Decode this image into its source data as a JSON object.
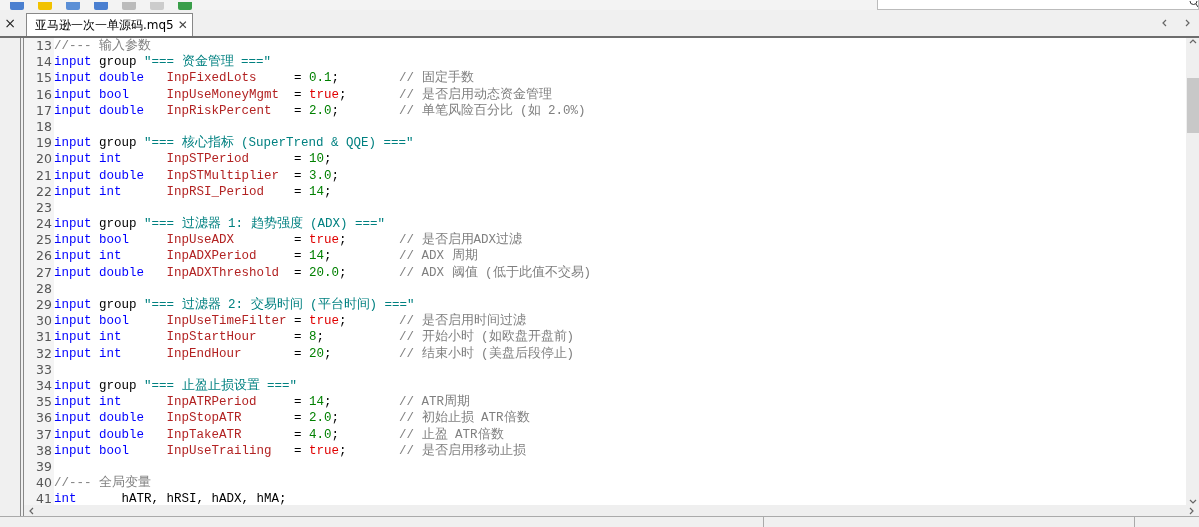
{
  "panel_close": "×",
  "tabs": [
    {
      "label": "亚马逊一次一单源码.mq5",
      "selected": true,
      "close": "✕"
    }
  ],
  "editor": {
    "lines": [
      {
        "number": "13",
        "tokens": [
          {
            "kind": "comment",
            "text": "//--- 输入参数"
          }
        ]
      },
      {
        "number": "14",
        "tokens": [
          {
            "kind": "keyword",
            "text": "input"
          },
          {
            "kind": "word",
            "text": "group"
          },
          {
            "kind": "string",
            "text": "\"=== 资金管理 ===\""
          }
        ]
      },
      {
        "number": "15",
        "tokens": [
          {
            "kind": "keyword",
            "text": "input"
          },
          {
            "kind": "type",
            "text": "double"
          },
          {
            "kind": "name",
            "text": "InpFixedLots"
          },
          {
            "kind": "op",
            "text": "="
          },
          {
            "kind": "number",
            "text": "0.1"
          },
          {
            "kind": "punct",
            "text": ";"
          },
          {
            "kind": "comment",
            "text": "// 固定手数"
          }
        ]
      },
      {
        "number": "16",
        "tokens": [
          {
            "kind": "keyword",
            "text": "input"
          },
          {
            "kind": "type",
            "text": "bool"
          },
          {
            "kind": "name",
            "text": "InpUseMoneyMgmt"
          },
          {
            "kind": "op",
            "text": "="
          },
          {
            "kind": "bool",
            "text": "true"
          },
          {
            "kind": "punct",
            "text": ";"
          },
          {
            "kind": "comment",
            "text": "// 是否启用动态资金管理"
          }
        ]
      },
      {
        "number": "17",
        "tokens": [
          {
            "kind": "keyword",
            "text": "input"
          },
          {
            "kind": "type",
            "text": "double"
          },
          {
            "kind": "name",
            "text": "InpRiskPercent"
          },
          {
            "kind": "op",
            "text": "="
          },
          {
            "kind": "number",
            "text": "2.0"
          },
          {
            "kind": "punct",
            "text": ";"
          },
          {
            "kind": "comment",
            "text": "// 单笔风险百分比 (如 2.0%)"
          }
        ]
      },
      {
        "number": "18"
      },
      {
        "number": "19",
        "tokens": [
          {
            "kind": "keyword",
            "text": "input"
          },
          {
            "kind": "word",
            "text": "group"
          },
          {
            "kind": "string",
            "text": "\"=== 核心指标 (SuperTrend & QQE) ===\""
          }
        ]
      },
      {
        "number": "20",
        "tokens": [
          {
            "kind": "keyword",
            "text": "input"
          },
          {
            "kind": "type",
            "text": "int"
          },
          {
            "kind": "name",
            "text": "InpSTPeriod"
          },
          {
            "kind": "op",
            "text": "="
          },
          {
            "kind": "number",
            "text": "10"
          },
          {
            "kind": "punct",
            "text": ";"
          }
        ]
      },
      {
        "number": "21",
        "tokens": [
          {
            "kind": "keyword",
            "text": "input"
          },
          {
            "kind": "type",
            "text": "double"
          },
          {
            "kind": "name",
            "text": "InpSTMultiplier"
          },
          {
            "kind": "op",
            "text": "="
          },
          {
            "kind": "number",
            "text": "3.0"
          },
          {
            "kind": "punct",
            "text": ";"
          }
        ]
      },
      {
        "number": "22",
        "tokens": [
          {
            "kind": "keyword",
            "text": "input"
          },
          {
            "kind": "type",
            "text": "int"
          },
          {
            "kind": "name",
            "text": "InpRSI_Period"
          },
          {
            "kind": "op",
            "text": "="
          },
          {
            "kind": "number",
            "text": "14"
          },
          {
            "kind": "punct",
            "text": ";"
          }
        ]
      },
      {
        "number": "23"
      },
      {
        "number": "24",
        "tokens": [
          {
            "kind": "keyword",
            "text": "input"
          },
          {
            "kind": "word",
            "text": "group"
          },
          {
            "kind": "string",
            "text": "\"=== 过滤器 1: 趋势强度 (ADX) ===\""
          }
        ]
      },
      {
        "number": "25",
        "tokens": [
          {
            "kind": "keyword",
            "text": "input"
          },
          {
            "kind": "type",
            "text": "bool"
          },
          {
            "kind": "name",
            "text": "InpUseADX"
          },
          {
            "kind": "op",
            "text": "="
          },
          {
            "kind": "bool",
            "text": "true"
          },
          {
            "kind": "punct",
            "text": ";"
          },
          {
            "kind": "comment",
            "text": "// 是否启用ADX过滤"
          }
        ]
      },
      {
        "number": "26",
        "tokens": [
          {
            "kind": "keyword",
            "text": "input"
          },
          {
            "kind": "type",
            "text": "int"
          },
          {
            "kind": "name",
            "text": "InpADXPeriod"
          },
          {
            "kind": "op",
            "text": "="
          },
          {
            "kind": "number",
            "text": "14"
          },
          {
            "kind": "punct",
            "text": ";"
          },
          {
            "kind": "comment",
            "text": "// ADX 周期"
          }
        ]
      },
      {
        "number": "27",
        "tokens": [
          {
            "kind": "keyword",
            "text": "input"
          },
          {
            "kind": "type",
            "text": "double"
          },
          {
            "kind": "name",
            "text": "InpADXThreshold"
          },
          {
            "kind": "op",
            "text": "="
          },
          {
            "kind": "number",
            "text": "20.0"
          },
          {
            "kind": "punct",
            "text": ";"
          },
          {
            "kind": "comment",
            "text": "// ADX 阈值 (低于此值不交易)"
          }
        ]
      },
      {
        "number": "28"
      },
      {
        "number": "29",
        "tokens": [
          {
            "kind": "keyword",
            "text": "input"
          },
          {
            "kind": "word",
            "text": "group"
          },
          {
            "kind": "string",
            "text": "\"=== 过滤器 2: 交易时间 (平台时间) ===\""
          }
        ]
      },
      {
        "number": "30",
        "tokens": [
          {
            "kind": "keyword",
            "text": "input"
          },
          {
            "kind": "type",
            "text": "bool"
          },
          {
            "kind": "name",
            "text": "InpUseTimeFilter"
          },
          {
            "kind": "op",
            "text": "="
          },
          {
            "kind": "bool",
            "text": "true"
          },
          {
            "kind": "punct",
            "text": ";"
          },
          {
            "kind": "comment",
            "text": "// 是否启用时间过滤"
          }
        ]
      },
      {
        "number": "31",
        "tokens": [
          {
            "kind": "keyword",
            "text": "input"
          },
          {
            "kind": "type",
            "text": "int"
          },
          {
            "kind": "name",
            "text": "InpStartHour"
          },
          {
            "kind": "op",
            "text": "="
          },
          {
            "kind": "number",
            "text": "8"
          },
          {
            "kind": "punct",
            "text": ";"
          },
          {
            "kind": "comment",
            "text": "// 开始小时 (如欧盘开盘前)"
          }
        ]
      },
      {
        "number": "32",
        "tokens": [
          {
            "kind": "keyword",
            "text": "input"
          },
          {
            "kind": "type",
            "text": "int"
          },
          {
            "kind": "name",
            "text": "InpEndHour"
          },
          {
            "kind": "op",
            "text": "="
          },
          {
            "kind": "number",
            "text": "20"
          },
          {
            "kind": "punct",
            "text": ";"
          },
          {
            "kind": "comment",
            "text": "// 结束小时 (美盘后段停止)"
          }
        ]
      },
      {
        "number": "33"
      },
      {
        "number": "34",
        "tokens": [
          {
            "kind": "keyword",
            "text": "input"
          },
          {
            "kind": "word",
            "text": "group"
          },
          {
            "kind": "string",
            "text": "\"=== 止盈止损设置 ===\""
          }
        ]
      },
      {
        "number": "35",
        "tokens": [
          {
            "kind": "keyword",
            "text": "input"
          },
          {
            "kind": "type",
            "text": "int"
          },
          {
            "kind": "name",
            "text": "InpATRPeriod"
          },
          {
            "kind": "op",
            "text": "="
          },
          {
            "kind": "number",
            "text": "14"
          },
          {
            "kind": "punct",
            "text": ";"
          },
          {
            "kind": "comment",
            "text": "// ATR周期"
          }
        ]
      },
      {
        "number": "36",
        "tokens": [
          {
            "kind": "keyword",
            "text": "input"
          },
          {
            "kind": "type",
            "text": "double"
          },
          {
            "kind": "name",
            "text": "InpStopATR"
          },
          {
            "kind": "op",
            "text": "="
          },
          {
            "kind": "number",
            "text": "2.0"
          },
          {
            "kind": "punct",
            "text": ";"
          },
          {
            "kind": "comment",
            "text": "// 初始止损 ATR倍数"
          }
        ]
      },
      {
        "number": "37",
        "tokens": [
          {
            "kind": "keyword",
            "text": "input"
          },
          {
            "kind": "type",
            "text": "double"
          },
          {
            "kind": "name",
            "text": "InpTakeATR"
          },
          {
            "kind": "op",
            "text": "="
          },
          {
            "kind": "number",
            "text": "4.0"
          },
          {
            "kind": "punct",
            "text": ";"
          },
          {
            "kind": "comment",
            "text": "// 止盈 ATR倍数"
          }
        ]
      },
      {
        "number": "38",
        "tokens": [
          {
            "kind": "keyword",
            "text": "input"
          },
          {
            "kind": "type",
            "text": "bool"
          },
          {
            "kind": "name",
            "text": "InpUseTrailing"
          },
          {
            "kind": "op",
            "text": "="
          },
          {
            "kind": "bool",
            "text": "true"
          },
          {
            "kind": "punct",
            "text": ";"
          },
          {
            "kind": "comment",
            "text": "// 是否启用移动止损"
          }
        ]
      },
      {
        "number": "39"
      },
      {
        "number": "40",
        "tokens": [
          {
            "kind": "comment",
            "text": "//--- 全局变量"
          }
        ]
      },
      {
        "number": "41",
        "tokens": [
          {
            "kind": "keyword",
            "text": "int"
          },
          {
            "kind": "plain",
            "text": "hATR, hRSI, hADX, hMA;"
          }
        ]
      }
    ]
  }
}
